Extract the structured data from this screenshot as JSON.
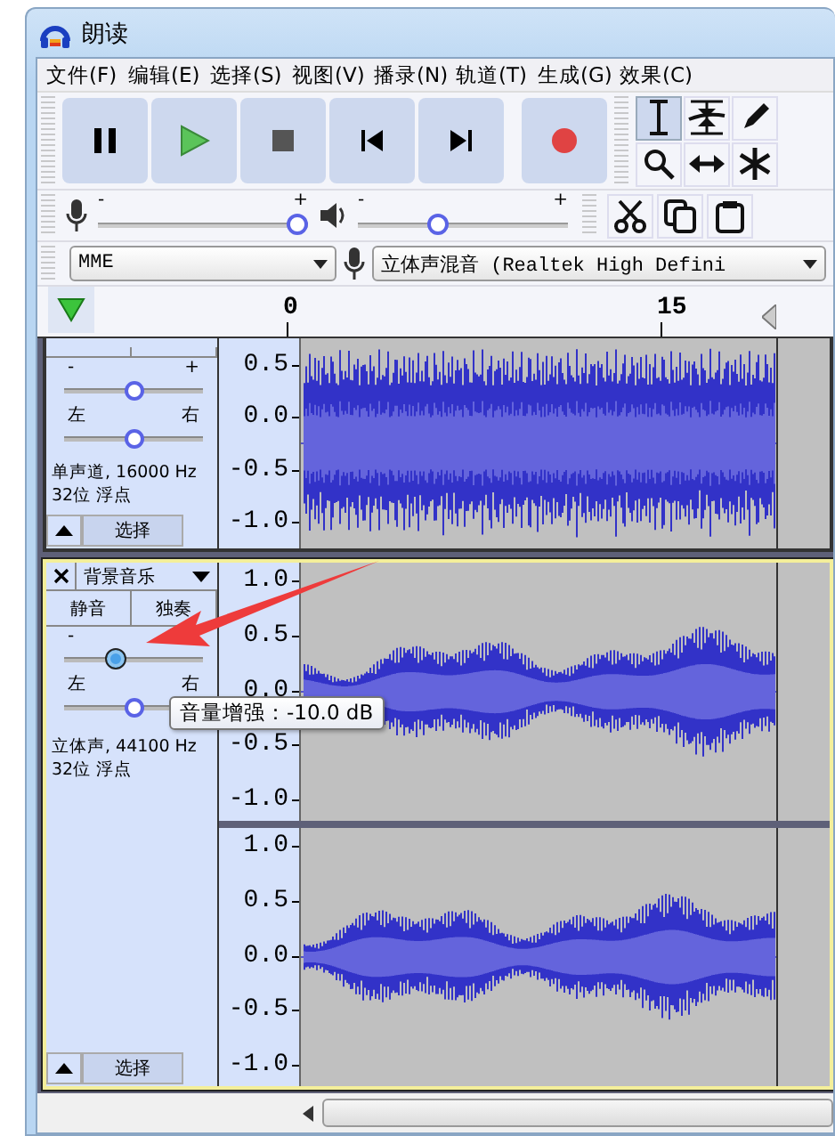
{
  "window": {
    "title": "朗读"
  },
  "menu": [
    "文件(F)",
    "编辑(E)",
    "选择(S)",
    "视图(V)",
    "播录(N)",
    "轨道(T)",
    "生成(G)",
    "效果(C)"
  ],
  "tools": [
    {
      "kind": "ibeam",
      "selected": true
    },
    {
      "kind": "envelope",
      "selected": false
    },
    {
      "kind": "pencil",
      "selected": false
    },
    {
      "kind": "zoom",
      "selected": false
    },
    {
      "kind": "timeshift",
      "selected": false
    },
    {
      "kind": "multi",
      "selected": false
    }
  ],
  "meters": [
    {
      "kind": "record",
      "minus": "-",
      "plus": "+",
      "level": 1.0
    },
    {
      "kind": "playback",
      "minus": "-",
      "plus": "+",
      "level": 0.37
    }
  ],
  "device_bar": {
    "host": "MME",
    "input": "立体声混音 (Realtek High Defini"
  },
  "ruler": {
    "ticks": [
      "0",
      "15"
    ]
  },
  "tracks": [
    {
      "focused": false,
      "gain": {
        "minus": "-",
        "plus": "+",
        "level": 0.5
      },
      "pan": {
        "left": "左",
        "right": "右",
        "level": 0.5
      },
      "format": "单声道, 16000 Hz",
      "sample": "32位 浮点",
      "select": "选择",
      "channels": [
        {
          "scale": [
            "0.5",
            "0.0",
            "-0.5",
            "-1.0"
          ]
        }
      ]
    },
    {
      "focused": true,
      "name": "背景音乐",
      "mute": "静音",
      "solo": "独奏",
      "gain": {
        "minus": "-",
        "level": 0.35
      },
      "pan": {
        "left": "左",
        "right": "右",
        "level": 0.5
      },
      "format": "立体声, 44100 Hz",
      "sample": "32位 浮点",
      "select": "选择",
      "channels": [
        {
          "scale": [
            "1.0",
            "0.5",
            "0.0",
            "-0.5",
            "-1.0"
          ]
        },
        {
          "scale": [
            "1.0",
            "0.5",
            "0.0",
            "-0.5",
            "-1.0"
          ]
        }
      ]
    }
  ],
  "tooltip": "音量增强：-10.0 dB"
}
